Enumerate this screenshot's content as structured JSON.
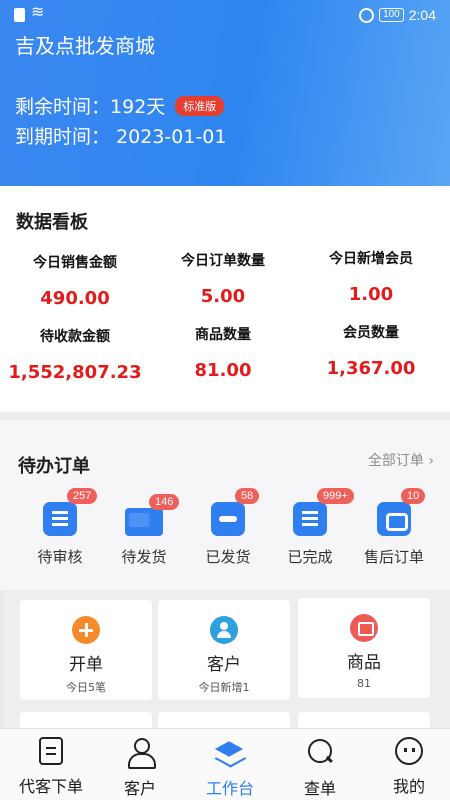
{
  "status_bar": {
    "battery": "100",
    "time": "2:04"
  },
  "header": {
    "shop_name": "吉及点批发商城",
    "remaining_label": "剩余时间：",
    "remaining_value": "192天",
    "edition_badge": "标准版",
    "expire_label": "到期时间：",
    "expire_value": "2023-01-01"
  },
  "dashboard": {
    "title": "数据看板",
    "metrics": [
      {
        "label": "今日销售金额",
        "value": "490.00"
      },
      {
        "label": "今日订单数量",
        "value": "5.00"
      },
      {
        "label": "今日新增会员",
        "value": "1.00"
      },
      {
        "label": "待收款金额",
        "value": "1,552,807.23"
      },
      {
        "label": "商品数量",
        "value": "81.00"
      },
      {
        "label": "会员数量",
        "value": "1,367.00"
      }
    ]
  },
  "pending_orders": {
    "title": "待办订单",
    "all_link": "全部订单",
    "items": [
      {
        "label": "待审核",
        "badge": "257",
        "icon": "clipboard-icon"
      },
      {
        "label": "待发货",
        "badge": "146",
        "icon": "truck-icon"
      },
      {
        "label": "已发货",
        "badge": "58",
        "icon": "wallet-icon"
      },
      {
        "label": "已完成",
        "badge": "999+",
        "icon": "document-icon"
      },
      {
        "label": "售后订单",
        "badge": "10",
        "icon": "return-icon"
      }
    ]
  },
  "shortcuts": [
    {
      "title": "开单",
      "sub": "今日5笔",
      "icon": "plus-icon"
    },
    {
      "title": "客户",
      "sub": "今日新增1",
      "icon": "person-icon"
    },
    {
      "title": "商品",
      "sub": "81",
      "icon": "goods-icon"
    }
  ],
  "bottom_nav": [
    {
      "label": "代客下单",
      "icon": "document-icon"
    },
    {
      "label": "客户",
      "icon": "user-icon"
    },
    {
      "label": "工作台",
      "icon": "layers-icon",
      "active": true
    },
    {
      "label": "查单",
      "icon": "search-icon"
    },
    {
      "label": "我的",
      "icon": "face-icon"
    }
  ],
  "colors": {
    "primary": "#2f7ff0",
    "value_red": "#e21b1b",
    "badge_red": "#f0605a",
    "edition_red": "#e53d2e"
  }
}
